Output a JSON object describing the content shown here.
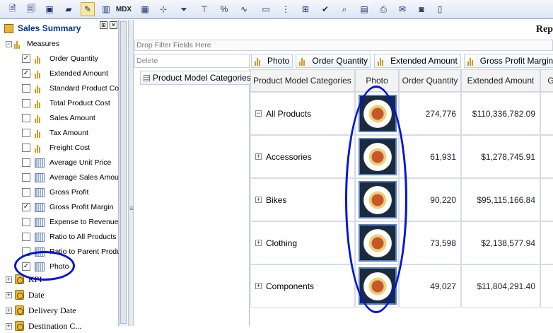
{
  "toolbar": {
    "mdx_label": "MDX",
    "buttons": [
      "new-report-icon",
      "open-icon",
      "save-icon",
      "folder-icon",
      "design-icon",
      "chart-icon",
      "mdx-icon",
      "grid-icon",
      "drill-icon",
      "filter-icon",
      "top-filter-icon",
      "percent-icon",
      "trend-icon",
      "kpi-icon",
      "hierarchy-icon",
      "export-icon",
      "check-icon",
      "search-icon",
      "save-as-icon",
      "print-icon",
      "mail-icon",
      "camera-icon",
      "document-icon"
    ]
  },
  "left_panel": {
    "title": "Sales Summary",
    "pin_button": "⊞",
    "close_button": "✕",
    "measures_label": "Measures",
    "measures": [
      {
        "label": "Order Quantity",
        "checked": true,
        "type": "measure"
      },
      {
        "label": "Extended Amount",
        "checked": true,
        "type": "measure"
      },
      {
        "label": "Standard Product Cos",
        "checked": false,
        "type": "measure"
      },
      {
        "label": "Total Product Cost",
        "checked": false,
        "type": "measure"
      },
      {
        "label": "Sales Amount",
        "checked": false,
        "type": "measure"
      },
      {
        "label": "Tax Amount",
        "checked": false,
        "type": "measure"
      },
      {
        "label": "Freight Cost",
        "checked": false,
        "type": "measure"
      },
      {
        "label": "Average Unit Price",
        "checked": false,
        "type": "calc"
      },
      {
        "label": "Average Sales Amou",
        "checked": false,
        "type": "calc"
      },
      {
        "label": "Gross Profit",
        "checked": false,
        "type": "calc"
      },
      {
        "label": "Gross Profit Margin",
        "checked": true,
        "type": "calc"
      },
      {
        "label": "Expense to Revenue",
        "checked": false,
        "type": "calc"
      },
      {
        "label": "Ratio to All Products",
        "checked": false,
        "type": "calc"
      },
      {
        "label": "Ratio to Parent Produ",
        "checked": false,
        "type": "calc"
      },
      {
        "label": "Photo",
        "checked": true,
        "type": "calc"
      }
    ],
    "dimensions": [
      {
        "label": "KPI"
      },
      {
        "label": "Date"
      },
      {
        "label": "Delivery Date"
      },
      {
        "label": "Destination C..."
      }
    ]
  },
  "report": {
    "title": "Rep",
    "drop_filter_placeholder": "Drop Filter Fields Here",
    "delete_label": "Delete",
    "row_field": "Product Model Categories",
    "column_fields": [
      "Photo",
      "Order Quantity",
      "Extended Amount",
      "Gross Profit Margin"
    ],
    "headers": {
      "category": "Product Model Categories",
      "photo": "Photo",
      "order_qty": "Order Quantity",
      "extended_amount": "Extended Amount",
      "next": "G"
    },
    "rows": [
      {
        "label": "All Products",
        "expander": "−",
        "order_qty": "274,776",
        "extended_amount": "$110,336,782.09"
      },
      {
        "label": "Accessories",
        "expander": "+",
        "order_qty": "61,931",
        "extended_amount": "$1,278,745.91"
      },
      {
        "label": "Bikes",
        "expander": "+",
        "order_qty": "90,220",
        "extended_amount": "$95,115,166.84"
      },
      {
        "label": "Clothing",
        "expander": "+",
        "order_qty": "73,598",
        "extended_amount": "$2,138,577.94"
      },
      {
        "label": "Components",
        "expander": "+",
        "order_qty": "49,027",
        "extended_amount": "$11,804,291.40"
      }
    ]
  },
  "colors": {
    "title_blue": "#003399",
    "highlight_oval": "#0014d8",
    "measure_icon": "#d79a16"
  }
}
